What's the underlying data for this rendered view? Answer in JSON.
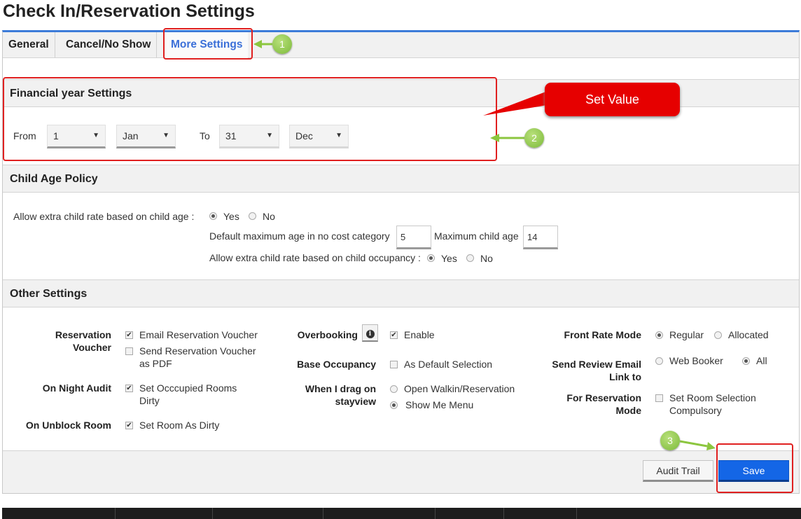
{
  "page": {
    "title": "Check In/Reservation Settings"
  },
  "tabs": [
    {
      "label": "General"
    },
    {
      "label": "Cancel/No Show"
    },
    {
      "label": "More Settings"
    }
  ],
  "financial": {
    "heading": "Financial year Settings",
    "from_label": "From",
    "to_label": "To",
    "from_day": "1",
    "from_month": "Jan",
    "to_day": "31",
    "to_month": "Dec"
  },
  "child": {
    "heading": "Child Age Policy",
    "extra_rate_label": "Allow extra child rate based on child age :",
    "yes": "Yes",
    "no": "No",
    "default_max_age_label": "Default maximum age in no cost category",
    "default_max_age_value": "5",
    "max_child_age_label": "Maximum child age",
    "max_child_age_value": "14",
    "occupancy_label": "Allow extra child rate based on child occupancy :",
    "age_rate_selected": "Yes",
    "occupancy_selected": "Yes"
  },
  "other": {
    "heading": "Other Settings",
    "reservation_voucher_label": "Reservation\nVoucher",
    "email_voucher": "Email Reservation Voucher",
    "pdf_voucher": "Send Reservation Voucher\nas PDF",
    "night_audit_label": "On Night Audit",
    "occupied_dirty": "Set Occcupied Rooms\nDirty",
    "unblock_label": "On Unblock Room",
    "room_dirty": "Set Room As Dirty",
    "overbooking_label": "Overbooking",
    "enable": "Enable",
    "base_occupancy_label": "Base Occupancy",
    "default_selection": "As Default Selection",
    "drag_label": "When I drag on\nstayview",
    "open_walkin": "Open Walkin/Reservation",
    "show_menu": "Show Me Menu",
    "front_rate_label": "Front Rate Mode",
    "regular": "Regular",
    "allocated": "Allocated",
    "review_email_label": "Send Review Email\nLink to",
    "web_booker": "Web Booker",
    "all": "All",
    "reservation_mode_label": "For Reservation\nMode",
    "room_selection": "Set Room Selection\nCompulsory"
  },
  "footer": {
    "audit_trail": "Audit Trail",
    "save": "Save"
  },
  "annotations": {
    "callout": "Set Value",
    "step1": "1",
    "step2": "2",
    "step3": "3"
  },
  "colors": {
    "accent": "#3c7bd9",
    "save": "#1466e6",
    "highlight": "#e02020",
    "step": "#7cba3a"
  }
}
